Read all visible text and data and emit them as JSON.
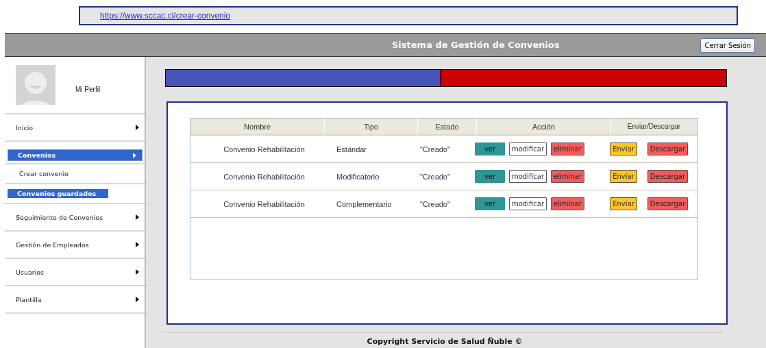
{
  "address_bar": {
    "url": "https://www.sccac.cl/crear-convenio"
  },
  "header": {
    "title": "Sistema de Gestión de Convenios",
    "logout_button": "Cerrar Sesión"
  },
  "profile": {
    "label": "Mi Perfil"
  },
  "sidebar": {
    "items": [
      {
        "label": "Inicio",
        "selected": false
      },
      {
        "label": "Convenios",
        "selected": true,
        "children": [
          {
            "label": "Crear convenio",
            "selected": false
          },
          {
            "label": "Convenios guardados",
            "selected": true
          }
        ]
      },
      {
        "label": "Seguimiento de Convenios",
        "selected": false
      },
      {
        "label": "Gestión de Empleados",
        "selected": false
      },
      {
        "label": "Usuarios",
        "selected": false
      },
      {
        "label": "Plantilla",
        "selected": false
      }
    ]
  },
  "progress": {
    "level": 0.49
  },
  "table": {
    "columns": [
      "Nombre",
      "Tipo",
      "Estado",
      "Acción",
      "Enviar/Descargar"
    ],
    "rows": [
      {
        "name": "Convenio Rehabilitación",
        "type": "Estándar",
        "status": "\"Creado\"",
        "actions": [
          "ver",
          "modificar",
          "eliminar"
        ],
        "transfer": [
          "Enviar",
          "Descargar"
        ]
      },
      {
        "name": "Convenio Rehabilitación",
        "type": "Modificatorio",
        "status": "\"Creado\"",
        "actions": [
          "ver",
          "modificar",
          "eliminar"
        ],
        "transfer": [
          "Enviar",
          "Descargar"
        ]
      },
      {
        "name": "Convenio Rehabilitación",
        "type": "Complementario",
        "status": "\"Creado\"",
        "actions": [
          "ver",
          "modificar",
          "eliminar"
        ],
        "transfer": [
          "Enviar",
          "Descargar"
        ]
      }
    ]
  },
  "footer": {
    "text": "Copyright Servicio de Salud Ñuble ©"
  }
}
